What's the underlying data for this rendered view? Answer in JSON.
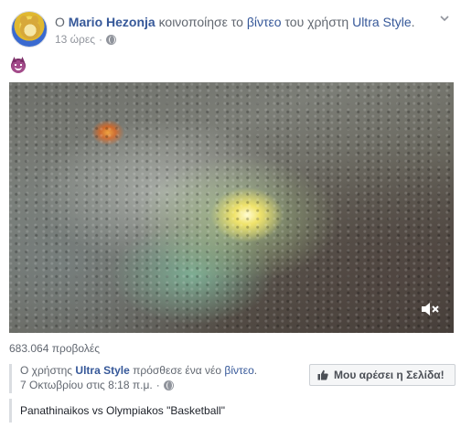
{
  "post": {
    "author_prefix": "Ο",
    "author": "Mario Hezonja",
    "shared_text": "κοινοποίησε το",
    "video_link": "βίντεο",
    "of_user": "του χρήστη",
    "source_page": "Ultra Style",
    "period": ".",
    "time": "13 ώρες",
    "views": "683.064 προβολές"
  },
  "shared": {
    "prefix": "Ο χρήστης",
    "page": "Ultra Style",
    "added_text": "πρόσθεσε ένα νέο",
    "video_link": "βίντεο",
    "period": ".",
    "date": "7 Οκτωβρίου στις 8:18 π.μ.",
    "title": "Panathinaikos vs Olympiakos \"Basketball\""
  },
  "like_button": {
    "label": "Μου αρέσει η Σελίδα!"
  },
  "icons": {
    "avatar": "avatar-lion",
    "globe": "globe-icon",
    "chevron": "chevron-down-icon",
    "emoji": "devil-emoji-icon",
    "mute": "mute-icon",
    "thumb": "thumbs-up-icon"
  },
  "colors": {
    "link": "#365899",
    "meta": "#90949c",
    "text": "#1d2129"
  }
}
